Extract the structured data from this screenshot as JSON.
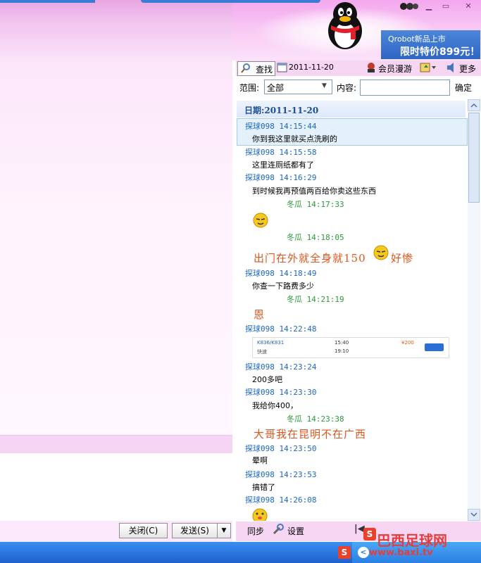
{
  "toolbar": {
    "search_label": "查找",
    "date_label": "2011-11-20",
    "member_label": "会员漫游",
    "more_label": "更多"
  },
  "ad": {
    "line1": "Qrobot新品上市",
    "line2": "限时特价899元！"
  },
  "filter": {
    "range_label": "范围:",
    "range_value": "全部",
    "content_label": "内容:",
    "content_value": "",
    "confirm_label": "确定"
  },
  "history": {
    "date_header": "日期:2011-11-20",
    "entries": [
      {
        "meta": "探球098  14:15:44",
        "text": "你到我这里就买点洗刷的"
      },
      {
        "meta": "探球098  14:15:58",
        "text": "这里连厕纸都有了"
      },
      {
        "meta": "探球098  14:16:29",
        "text": "到时候我再预值两百给你卖这些东西"
      },
      {
        "meta": "冬瓜  14:17:33",
        "text": ""
      },
      {
        "meta": "冬瓜  14:18:05",
        "text": "出门在外就全身就150"
      },
      {
        "meta": "",
        "text": "好惨"
      },
      {
        "meta": "探球098  14:18:49",
        "text": "你查一下路费多少"
      },
      {
        "meta": "冬瓜  14:21:19",
        "text": "恩"
      },
      {
        "meta": "探球098  14:22:48",
        "text": ""
      },
      {
        "meta": "探球098  14:23:24",
        "text": "200多吧"
      },
      {
        "meta": "探球098  14:23:30",
        "text": "我给你400，"
      },
      {
        "meta": "冬瓜  14:23:38",
        "text": "大哥我在昆明不在广西"
      },
      {
        "meta": "探球098  14:23:50",
        "text": "晕啊"
      },
      {
        "meta": "探球098  14:23:53",
        "text": "搞错了"
      },
      {
        "meta": "探球098  14:26:08",
        "text": ""
      }
    ],
    "ticket": {
      "train": "K836/K831",
      "from": "快速",
      "depart": "15:40",
      "arrive": "19:10",
      "price": "¥200"
    }
  },
  "bottom": {
    "close_label": "关闭(C)",
    "send_label": "发送(S)",
    "sync_label": "同步",
    "settings_label": "设置"
  },
  "watermark": {
    "main": "巴西足球网",
    "sub": "www.baxi.tv"
  }
}
